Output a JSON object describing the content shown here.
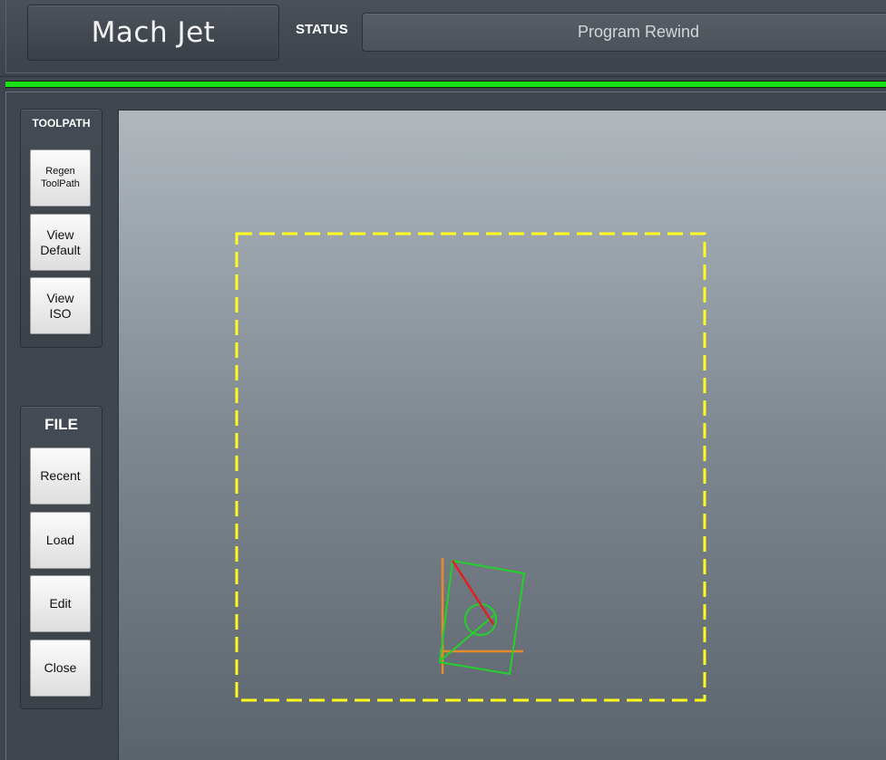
{
  "header": {
    "logo_text": "Mach Jet",
    "status_label": "STATUS",
    "status_text": "Program Rewind",
    "progress_percent": 100,
    "progress_color": "#17e014"
  },
  "toolpath_panel": {
    "title": "TOOLPATH",
    "buttons": [
      {
        "label": "Regen\nToolPath"
      },
      {
        "label": "View\nDefault"
      },
      {
        "label": "View\nISO"
      }
    ]
  },
  "file_panel": {
    "title": "FILE",
    "buttons": [
      {
        "label": "Recent"
      },
      {
        "label": "Load"
      },
      {
        "label": "Edit"
      },
      {
        "label": "Close"
      }
    ]
  },
  "viewport": {
    "boundary_color": "#ffff1e",
    "toolpath_color": "#22d22a",
    "axis_x_color": "#e8892a",
    "axis_y_color": "#e8892a",
    "current_move_color": "#e02020"
  }
}
